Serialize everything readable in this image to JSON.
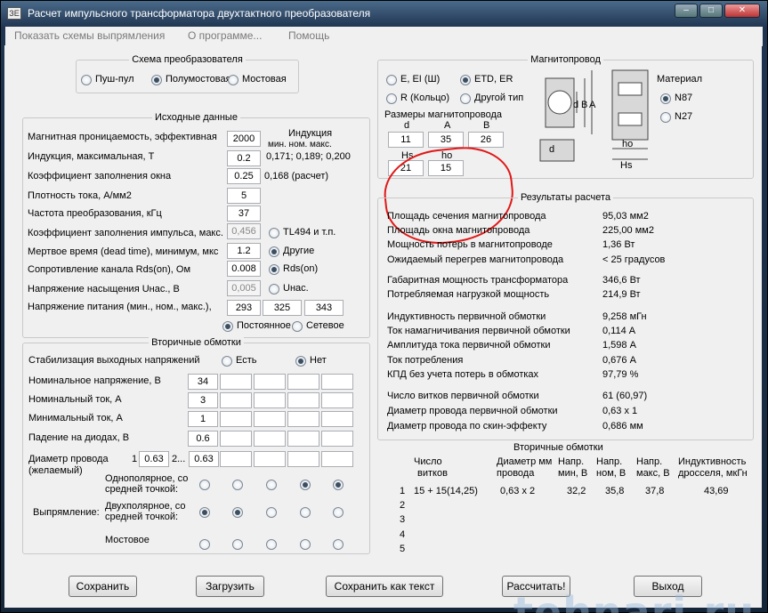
{
  "window": {
    "title": "Расчет импульсного трансформатора двухтактного преобразователя",
    "app_icon": "ЗЕ"
  },
  "menu": [
    "Показать схемы выпрямления",
    "О программе...",
    "Помощь"
  ],
  "scheme": {
    "title": "Схема преобразователя",
    "options": [
      "Пуш-пул",
      "Полумостовая",
      "Мостовая"
    ],
    "selected": 1
  },
  "input": {
    "title": "Исходные данные",
    "induction_title": "Индукция",
    "induction_header": "мин.  ном.  макс.",
    "induction_values": "0,171; 0,189; 0,200",
    "rows": [
      {
        "label": "Магнитная проницаемость, эффективная",
        "value": "2000"
      },
      {
        "label": "Индукция, максимальная, Т",
        "value": "0.2"
      },
      {
        "label": "Коэффициент заполнения окна",
        "value": "0.25"
      },
      {
        "label": "Плотность тока, А/мм2",
        "value": "5"
      },
      {
        "label": "Частота преобразования, кГц",
        "value": "37"
      },
      {
        "label": "Коэффициент заполнения импульса, макс.",
        "value": "0,456"
      },
      {
        "label": "Мертвое время (dead time), минимум, мкс",
        "value": "1.2"
      },
      {
        "label": "Сопротивление канала Rds(on), Ом",
        "value": "0.008"
      },
      {
        "label": "Напряжение насыщения Uнас., В",
        "value": "0,005"
      },
      {
        "label": "Напряжение питания (мин., ном., макс.),",
        "value": "293"
      }
    ],
    "fill_calc": "0,168 (расчет)",
    "supply_nom": "325",
    "supply_max": "343",
    "duty_options": [
      "TL494 и т.п.",
      "Другие"
    ],
    "duty_selected": 1,
    "rds_options": [
      "Rds(on)",
      "Uнас."
    ],
    "rds_selected": 0,
    "supply_options": [
      "Постоянное",
      "Сетевое"
    ],
    "supply_selected": 0
  },
  "secondary": {
    "title": "Вторичные обмотки",
    "stab_label": "Стабилизация выходных напряжений",
    "stab_options": [
      "Есть",
      "Нет"
    ],
    "stab_selected": 1,
    "rows": [
      {
        "label": "Номинальное напряжение, В",
        "value": "34"
      },
      {
        "label": "Номинальный ток, А",
        "value": "3"
      },
      {
        "label": "Минимальный ток, А",
        "value": "1"
      },
      {
        "label": "Падение на диодах, В",
        "value": "0.6"
      }
    ],
    "wire_label1": "Диаметр провода",
    "wire_label2": "(желаемый)",
    "wire_idx1": "1",
    "wire_val1": "0.63",
    "wire_idx2": "2...",
    "wire_val2": "0.63",
    "rect_label": "Выпрямление:",
    "rect_rows": [
      {
        "label1": "Однополярное, со",
        "label2": "средней точкой:",
        "selected": [
          false,
          false,
          false,
          true,
          true
        ]
      },
      {
        "label1": "Двухполярное, со",
        "label2": "средней точкой:",
        "selected": [
          true,
          true,
          false,
          false,
          false
        ]
      },
      {
        "label1": "Мостовое",
        "label2": "",
        "selected": [
          false,
          false,
          false,
          false,
          false
        ]
      }
    ]
  },
  "core": {
    "title": "Магнитопровод",
    "options": [
      "E, EI (Ш)",
      "ETD, ER",
      "R (Кольцо)",
      "Другой тип"
    ],
    "selected": 1,
    "sizes_title": "Размеры магнитопровода",
    "dims": [
      {
        "name": "d",
        "value": "11"
      },
      {
        "name": "A",
        "value": "35"
      },
      {
        "name": "B",
        "value": "26"
      },
      {
        "name": "Hs",
        "value": "21"
      },
      {
        "name": "ho",
        "value": "15"
      }
    ],
    "material_title": "Материал",
    "materials": [
      "N87",
      "N27"
    ],
    "material_selected": 0,
    "drawing_labels": {
      "d_left": "d",
      "b": "B",
      "a": "A",
      "d_bottom": "d",
      "ho": "ho",
      "hs": "Hs"
    }
  },
  "results": {
    "title": "Результаты расчета",
    "rows": [
      {
        "label": "Площадь сечения магнитопровода",
        "value": "95,03 мм2"
      },
      {
        "label": "Площадь окна магнитопровода",
        "value": "225,00 мм2"
      },
      {
        "label": "Мощность потерь в магнитопроводе",
        "value": "1,36 Вт"
      },
      {
        "label": "Ожидаемый перегрев магнитопровода",
        "value": "< 25 градусов"
      },
      {
        "label": "Габаритная мощность трансформатора",
        "value": "346,6 Вт"
      },
      {
        "label": "Потребляемая нагрузкой мощность",
        "value": "214,9 Вт"
      },
      {
        "label": "Индуктивность первичной обмотки",
        "value": "9,258 мГн"
      },
      {
        "label": "Ток намагничивания первичной обмотки",
        "value": "0,114 А"
      },
      {
        "label": "Амплитуда тока первичной обмотки",
        "value": "1,598 А"
      },
      {
        "label": "Ток потребления",
        "value": "0,676 А"
      },
      {
        "label": "КПД без учета потерь в обмотках",
        "value": "97,79 %"
      },
      {
        "label": "Число витков первичной обмотки",
        "value": "61 (60,97)"
      },
      {
        "label": "Диаметр провода первичной обмотки",
        "value": "0,63 х 1"
      },
      {
        "label": "Диаметр провода по скин-эффекту",
        "value": "0,686 мм"
      }
    ],
    "sec_title": "Вторичные обмотки",
    "sec_headers": [
      [
        "Число",
        "витков"
      ],
      [
        "Диаметр мм",
        "провода"
      ],
      [
        "Напр.",
        "мин, В"
      ],
      [
        "Напр.",
        "ном, В"
      ],
      [
        "Напр.",
        "макс, В"
      ],
      [
        "Индуктивность",
        "дросселя, мкГн"
      ]
    ],
    "sec_rows": [
      {
        "n": "1",
        "turns": "15 + 15(14,25)",
        "wire": "0,63 х 2",
        "umin": "32,2",
        "unom": "35,8",
        "umax": "37,8",
        "ind": "43,69"
      },
      {
        "n": "2",
        "turns": "",
        "wire": "",
        "umin": "",
        "unom": "",
        "umax": "",
        "ind": ""
      },
      {
        "n": "3",
        "turns": "",
        "wire": "",
        "umin": "",
        "unom": "",
        "umax": "",
        "ind": ""
      },
      {
        "n": "4",
        "turns": "",
        "wire": "",
        "umin": "",
        "unom": "",
        "umax": "",
        "ind": ""
      },
      {
        "n": "5",
        "turns": "",
        "wire": "",
        "umin": "",
        "unom": "",
        "umax": "",
        "ind": ""
      }
    ]
  },
  "buttons": {
    "save": "Сохранить",
    "load": "Загрузить",
    "save_text": "Сохранить как текст",
    "calc": "Рассчитать!",
    "exit": "Выход"
  },
  "watermark": "tehnari.ru",
  "colors": {
    "annotation_circle": "#e01818",
    "window_frame": "#1f3450"
  }
}
